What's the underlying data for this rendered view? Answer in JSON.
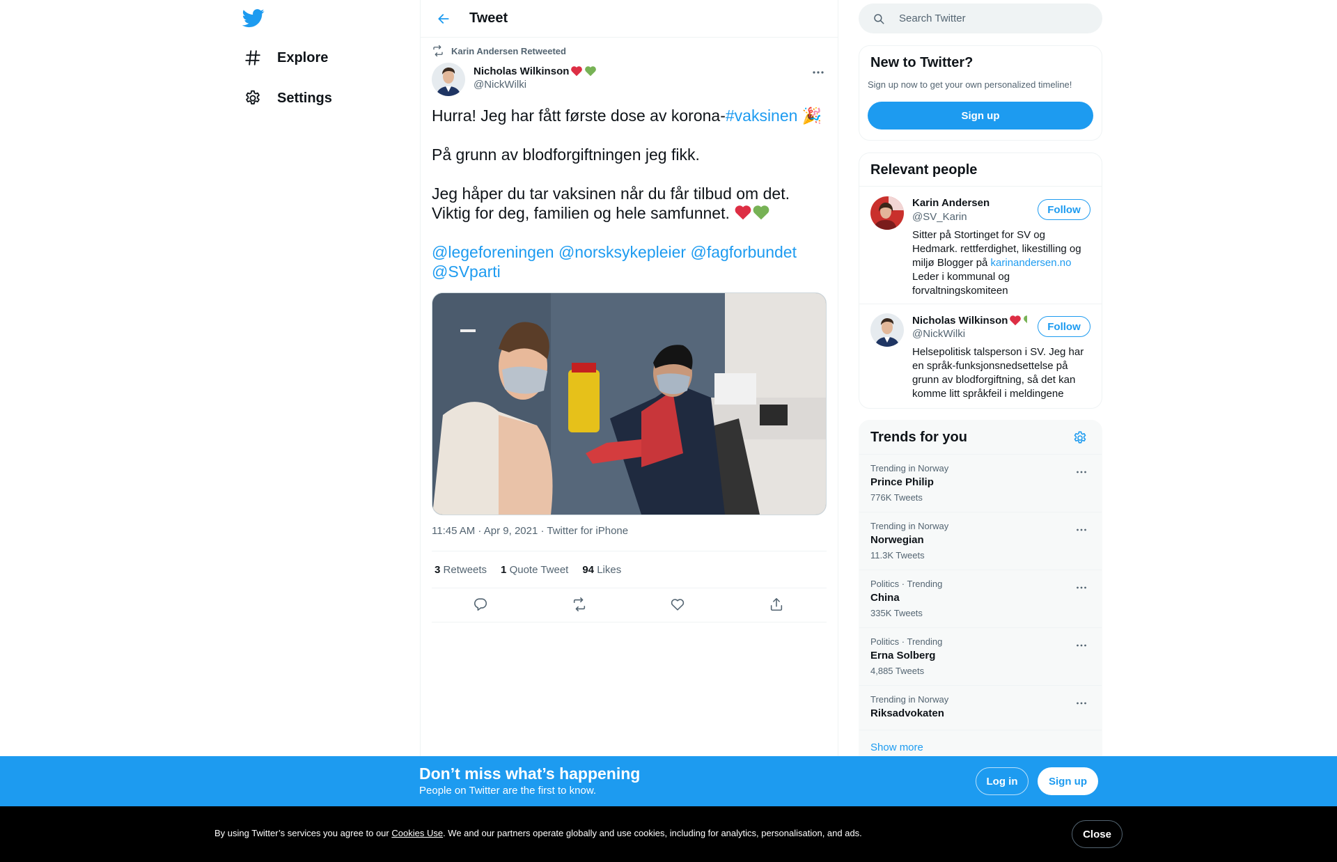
{
  "nav": {
    "explore_label": "Explore",
    "settings_label": "Settings"
  },
  "header": {
    "title": "Tweet"
  },
  "tweet": {
    "retweeted_by": "Karin Andersen Retweeted",
    "author_name": "Nicholas Wilkinson",
    "author_handle": "@NickWilki",
    "line1_text": "Hurra! Jeg har fått første dose av korona-",
    "line1_hashtag": "#vaksinen",
    "line1_emoji": "🎉",
    "line2": "På grunn av blodforgiftningen jeg fikk.",
    "line3": "Jeg håper du tar vaksinen når du får tilbud om det.",
    "line4": "Viktig for deg, familien og hele samfunnet.",
    "mentions": [
      "@legeforeningen",
      "@norsksykepleier",
      "@fagforbundet",
      "@SVparti"
    ],
    "timestamp": "11:45 AM · Apr 9, 2021 · Twitter for iPhone",
    "retweets_count": "3",
    "retweets_label": "Retweets",
    "quotes_count": "1",
    "quotes_label": "Quote Tweet",
    "likes_count": "94",
    "likes_label": "Likes"
  },
  "search": {
    "placeholder": "Search Twitter"
  },
  "new_to_twitter": {
    "title": "New to Twitter?",
    "subtitle": "Sign up now to get your own personalized timeline!",
    "signup_label": "Sign up"
  },
  "relevant_people": {
    "title": "Relevant people",
    "people": [
      {
        "name": "Karin Andersen",
        "handle": "@SV_Karin",
        "bio_pre": "Sitter på Stortinget for SV og Hedmark. rettferdighet, likestilling og miljø Blogger på ",
        "bio_link": "karinandersen.no",
        "bio_post": " Leder i kommunal og forvaltningskomiteen",
        "follow_label": "Follow"
      },
      {
        "name": "Nicholas Wilkinson",
        "handle": "@NickWilki",
        "bio_pre": "Helsepolitisk talsperson i SV. Jeg har en språk-funksjonsnedsettelse på grunn av blodforgiftning, så det kan komme litt språkfeil i meldingene",
        "follow_label": "Follow"
      }
    ]
  },
  "trends": {
    "title": "Trends for you",
    "items": [
      {
        "meta": "Trending in Norway",
        "name": "Prince Philip",
        "count": "776K Tweets"
      },
      {
        "meta": "Trending in Norway",
        "name": "Norwegian",
        "count": "11.3K Tweets"
      },
      {
        "meta": "Politics · Trending",
        "name": "China",
        "count": "335K Tweets"
      },
      {
        "meta": "Politics · Trending",
        "name": "Erna Solberg",
        "count": "4,885 Tweets"
      },
      {
        "meta": "Trending in Norway",
        "name": "Riksadvokaten",
        "count": ""
      }
    ],
    "show_more": "Show more"
  },
  "bottom_bar": {
    "title": "Don’t miss what’s happening",
    "subtitle": "People on Twitter are the first to know.",
    "login_label": "Log in",
    "signup_label": "Sign up"
  },
  "cookie": {
    "text_pre": "By using Twitter’s services you agree to our ",
    "link": "Cookies Use",
    "text_post": ". We and our partners operate globally and use cookies, including for analytics, personalisation, and ads.",
    "close_label": "Close"
  },
  "colors": {
    "brand": "#1d9bf0",
    "text": "#0f1419",
    "secondary": "#536471"
  }
}
